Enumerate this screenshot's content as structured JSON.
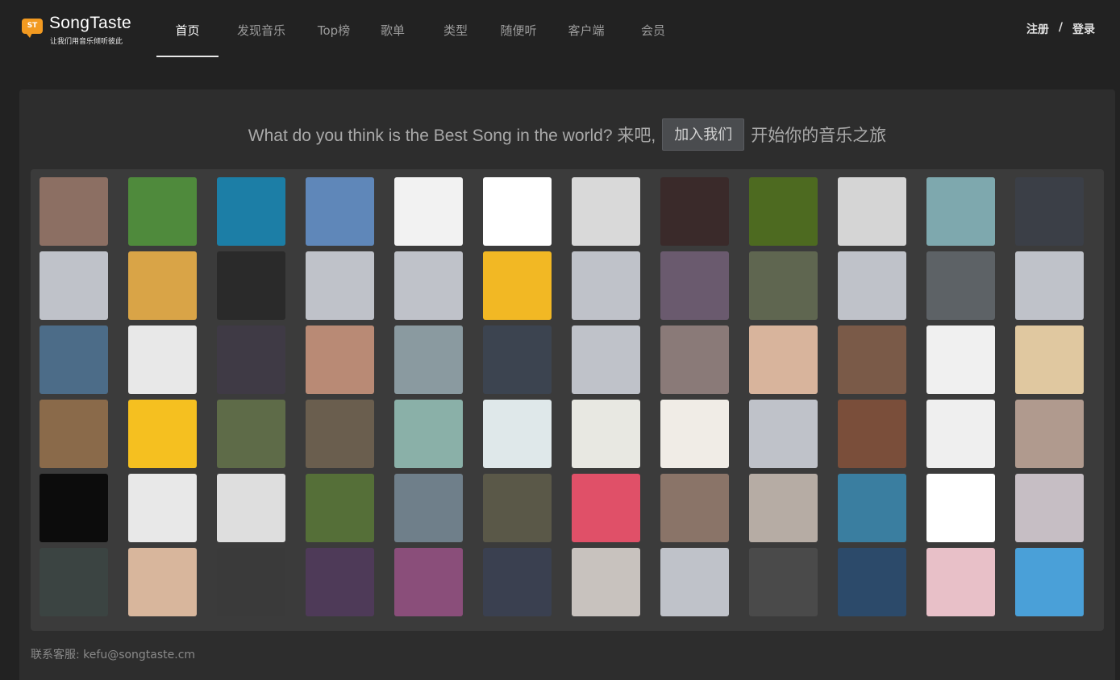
{
  "logo": {
    "badge": "ST",
    "name": "SongTaste",
    "tagline": "让我们用音乐倾听彼此"
  },
  "nav": [
    {
      "label": "首页",
      "active": true
    },
    {
      "label": "发现音乐"
    },
    {
      "label": "Top榜"
    },
    {
      "label": "歌单"
    },
    {
      "label": "类型"
    },
    {
      "label": "随便听"
    },
    {
      "label": "客户端"
    },
    {
      "label": "会员"
    }
  ],
  "auth": {
    "register": "注册",
    "separator": "/",
    "login": "登录"
  },
  "hero": {
    "question": "What do you think is the Best Song in the world? 来吧,",
    "join_button": "加入我们",
    "tail": "开始你的音乐之旅"
  },
  "avatars": [
    "#8c6f63",
    "#4f8a3c",
    "#1c7ea6",
    "#5f87b9",
    "#f2f2f2",
    "#ffffff",
    "#d9d9d9",
    "#3a2a2a",
    "#4d6a20",
    "#d5d5d5",
    "#7ea8ae",
    "#3b3f47",
    "#bfc2c9",
    "#d9a447",
    "#2a2a2a",
    "#bfc2c9",
    "#bfc2c9",
    "#f2b824",
    "#bfc2c9",
    "#6a5a6e",
    "#5f6650",
    "#bfc2c9",
    "#5d6266",
    "#bfc2c9",
    "#4c6c88",
    "#e8e8e8",
    "#3f3a45",
    "#b98a75",
    "#8a9aa0",
    "#3c4450",
    "#bfc2c9",
    "#8a7a78",
    "#d8b49c",
    "#7a5a48",
    "#f0f0f0",
    "#e0c8a0",
    "#8a6a4a",
    "#f5c020",
    "#5e6b48",
    "#6a5e4e",
    "#8ab0a8",
    "#dfe8ea",
    "#e8e8e2",
    "#f0ece6",
    "#bfc2c9",
    "#7a4e3a",
    "#efefef",
    "#b09a8e",
    "#0c0c0c",
    "#e8e8e8",
    "#dedede",
    "#556f38",
    "#6f7f8a",
    "#5a5848",
    "#e05068",
    "#8a7468",
    "#b6aca4",
    "#3a7ea0",
    "#ffffff",
    "#c6bec4",
    "#3b4442",
    "#d8b69c",
    "#3a3a3a",
    "#4e3a58",
    "#8a4e7a",
    "#3a4050",
    "#c8c2be",
    "#bfc2c9",
    "#4a4a4a",
    "#2c4a6a",
    "#e8c0c8",
    "#4aa0d8"
  ],
  "footer": {
    "contact": "联系客服: kefu@songtaste.cm"
  }
}
